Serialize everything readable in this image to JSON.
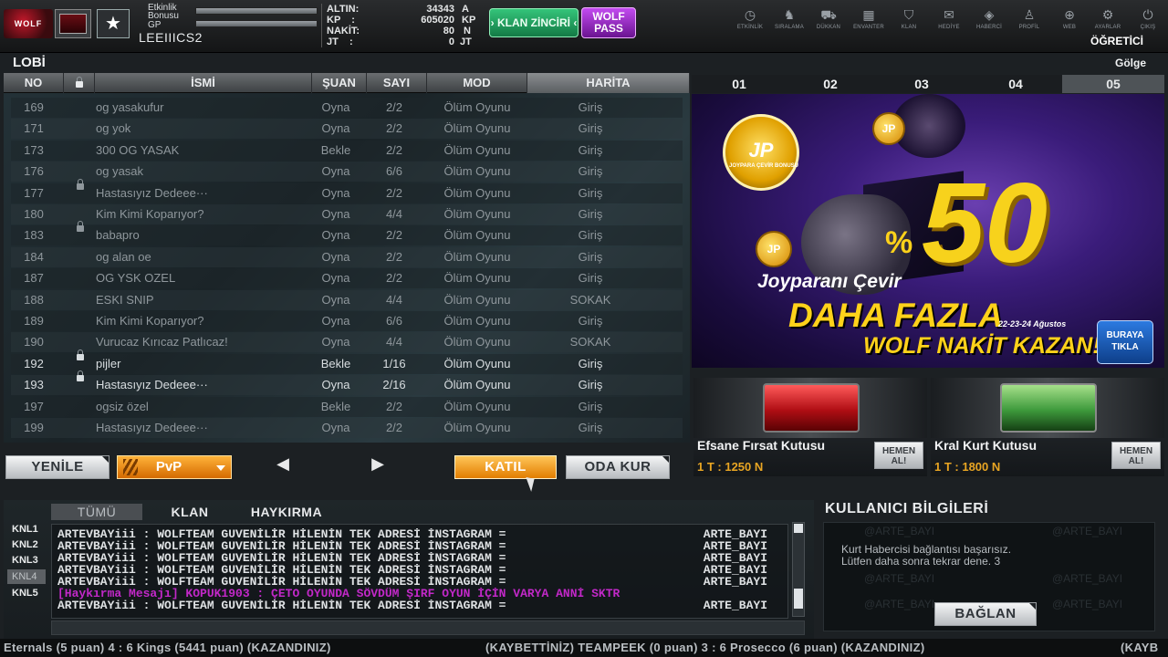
{
  "header": {
    "logo_text": "WOLF",
    "event_bonus_label": "Etkinlik\nBonusu",
    "gp_label": "GP",
    "nickname": "LEEIIICS2",
    "currencies": [
      {
        "label": "ALTIN:",
        "value": "34343",
        "unit": "A"
      },
      {
        "label": "KP    :",
        "value": "605020",
        "unit": "KP"
      },
      {
        "label": "NAKİT:",
        "value": "80",
        "unit": "N"
      },
      {
        "label": "JT    :",
        "value": "0",
        "unit": "JT"
      }
    ],
    "klan_chain_label": "› KLAN ZİNCİRİ ‹",
    "wolf_pass_label": "WOLF PASS",
    "tutor_label": "ÖĞRETİCİ"
  },
  "nav": [
    {
      "label": "ETKİNLİK",
      "icon": "clock-icon",
      "glyph": "◷"
    },
    {
      "label": "SIRALAMA",
      "icon": "ranking-icon",
      "glyph": "♞"
    },
    {
      "label": "DÜKKAN",
      "icon": "cart-icon",
      "glyph": "⛟"
    },
    {
      "label": "ENVANTER",
      "icon": "inventory-icon",
      "glyph": "▦"
    },
    {
      "label": "KLAN",
      "icon": "shield-icon",
      "glyph": "⛉"
    },
    {
      "label": "HEDİYE",
      "icon": "gift-icon",
      "glyph": "✉"
    },
    {
      "label": "HABERCİ",
      "icon": "megaphone-icon",
      "glyph": "◈"
    },
    {
      "label": "PROFİL",
      "icon": "profile-icon",
      "glyph": "♙"
    },
    {
      "label": "WEB",
      "icon": "globe-icon",
      "glyph": "⊕"
    },
    {
      "label": "AYARLAR",
      "icon": "gear-icon",
      "glyph": "⚙"
    },
    {
      "label": "ÇIKIŞ",
      "icon": "power-icon",
      "glyph": "⏻"
    }
  ],
  "lobby": {
    "title": "LOBİ",
    "shadow_label": "Gölge",
    "columns": [
      "NO",
      "İSMİ",
      "ŞUAN",
      "SAYI",
      "MOD",
      "HARİTA"
    ],
    "rooms": [
      {
        "no": "169",
        "locked": false,
        "name": "og yasakufur",
        "status": "Oyna",
        "count": "2/2",
        "mode": "Ölüm Oyunu",
        "map": "Giriş",
        "active": false
      },
      {
        "no": "171",
        "locked": false,
        "name": "og yok",
        "status": "Oyna",
        "count": "2/2",
        "mode": "Ölüm Oyunu",
        "map": "Giriş",
        "active": false
      },
      {
        "no": "173",
        "locked": false,
        "name": "300 OG YASAK",
        "status": "Bekle",
        "count": "2/2",
        "mode": "Ölüm Oyunu",
        "map": "Giriş",
        "active": false
      },
      {
        "no": "176",
        "locked": false,
        "name": "og yasak",
        "status": "Oyna",
        "count": "6/6",
        "mode": "Ölüm Oyunu",
        "map": "Giriş",
        "active": false
      },
      {
        "no": "177",
        "locked": true,
        "name": "Hastasıyız Dedeee···",
        "status": "Oyna",
        "count": "2/2",
        "mode": "Ölüm Oyunu",
        "map": "Giriş",
        "active": false
      },
      {
        "no": "180",
        "locked": false,
        "name": "Kim Kimi Koparıyor?",
        "status": "Oyna",
        "count": "4/4",
        "mode": "Ölüm Oyunu",
        "map": "Giriş",
        "active": false
      },
      {
        "no": "183",
        "locked": true,
        "name": "babapro",
        "status": "Oyna",
        "count": "2/2",
        "mode": "Ölüm Oyunu",
        "map": "Giriş",
        "active": false
      },
      {
        "no": "184",
        "locked": false,
        "name": "og alan oe",
        "status": "Oyna",
        "count": "2/2",
        "mode": "Ölüm Oyunu",
        "map": "Giriş",
        "active": false
      },
      {
        "no": "187",
        "locked": false,
        "name": "OG YSK OZEL",
        "status": "Oyna",
        "count": "2/2",
        "mode": "Ölüm Oyunu",
        "map": "Giriş",
        "active": false
      },
      {
        "no": "188",
        "locked": false,
        "name": "ESKI SNIP",
        "status": "Oyna",
        "count": "4/4",
        "mode": "Ölüm Oyunu",
        "map": "SOKAK",
        "active": false
      },
      {
        "no": "189",
        "locked": false,
        "name": "Kim Kimi Koparıyor?",
        "status": "Oyna",
        "count": "6/6",
        "mode": "Ölüm Oyunu",
        "map": "Giriş",
        "active": false
      },
      {
        "no": "190",
        "locked": false,
        "name": "Vurucaz Kırıcaz Patlıcaz!",
        "status": "Oyna",
        "count": "4/4",
        "mode": "Ölüm Oyunu",
        "map": "SOKAK",
        "active": false
      },
      {
        "no": "192",
        "locked": true,
        "name": "pijler",
        "status": "Bekle",
        "count": "1/16",
        "mode": "Ölüm Oyunu",
        "map": "Giriş",
        "active": true
      },
      {
        "no": "193",
        "locked": true,
        "name": "Hastasıyız Dedeee···",
        "status": "Oyna",
        "count": "2/16",
        "mode": "Ölüm Oyunu",
        "map": "Giriş",
        "active": true
      },
      {
        "no": "197",
        "locked": false,
        "name": "ogsiz özel",
        "status": "Bekle",
        "count": "2/2",
        "mode": "Ölüm Oyunu",
        "map": "Giriş",
        "active": false
      },
      {
        "no": "199",
        "locked": false,
        "name": "Hastasıyız Dedeee···",
        "status": "Oyna",
        "count": "2/2",
        "mode": "Ölüm Oyunu",
        "map": "Giriş",
        "active": false
      }
    ],
    "buttons": {
      "refresh": "YENİLE",
      "mode_select": "PvP",
      "prev": "◀",
      "next": "▶",
      "join": "KATIL",
      "create_room": "ODA KUR"
    }
  },
  "promo": {
    "tabs": [
      "01",
      "02",
      "03",
      "04",
      "05"
    ],
    "banner": {
      "badge": "JP",
      "badge_caption": "JOYPARA ÇEVİR BONUSU",
      "percent_sign": "%",
      "percent_value": "50",
      "line1": "Joyparanı Çevir",
      "line2": "DAHA FAZLA",
      "line3": "WOLF NAKİT KAZAN!",
      "dates": "22-23-24 Ağustos",
      "cta": "BURAYA TIKLA"
    },
    "shop": [
      {
        "name": "Efsane Fırsat Kutusu",
        "price": "1 T : 1250 N",
        "buy": "HEMEN AL!"
      },
      {
        "name": "Kral Kurt Kutusu",
        "price": "1 T : 1800 N",
        "buy": "HEMEN AL!"
      }
    ]
  },
  "chat": {
    "tabs": [
      "TÜMÜ",
      "KLAN",
      "HAYKIRMA"
    ],
    "channels": [
      "KNL1",
      "KNL2",
      "KNL3",
      "KNL4",
      "KNL5"
    ],
    "selected_channel": "KNL4",
    "lines": [
      {
        "text": "ARTEVBAYiii : WOLFTEAM GUVENİLİR HİLENİN TEK ADRESİ İNSTAGRAM =",
        "tail": "ARTE_BAYI",
        "shout": false
      },
      {
        "text": "ARTEVBAYiii : WOLFTEAM GUVENİLİR HİLENİN TEK ADRESİ İNSTAGRAM =",
        "tail": "ARTE_BAYI",
        "shout": false
      },
      {
        "text": "ARTEVBAYiii : WOLFTEAM GUVENİLİR HİLENİN TEK ADRESİ İNSTAGRAM =",
        "tail": "ARTE_BAYI",
        "shout": false
      },
      {
        "text": "ARTEVBAYiii : WOLFTEAM GUVENİLİR HİLENİN TEK ADRESİ İNSTAGRAM =",
        "tail": "ARTE_BAYI",
        "shout": false
      },
      {
        "text": "ARTEVBAYiii : WOLFTEAM GUVENİLİR HİLENİN TEK ADRESİ İNSTAGRAM =",
        "tail": "ARTE_BAYI",
        "shout": false
      },
      {
        "text": "[Haykırma Mesajı] KOPUK1903 : ÇETO OYUNDA SÖVDÜM ŞIRF OYUN İÇİN VARYA ANNİ SKTR",
        "tail": "",
        "shout": true
      },
      {
        "text": "ARTEVBAYiii : WOLFTEAM GUVENİLİR HİLENİN TEK ADRESİ İNSTAGRAM =",
        "tail": "ARTE_BAYI",
        "shout": false
      }
    ]
  },
  "user_info": {
    "title": "KULLANICI BİLGİLERİ",
    "message_line1": "Kurt Habercisi bağlantısı başarısız.",
    "message_line2": "Lütfen daha sonra tekrar dene. 3",
    "watermark": "@ARTE_BAYI",
    "connect_button": "BAĞLAN"
  },
  "ticker": {
    "left": "Eternals (5 puan) 4 : 6 Kings (5441 puan) (KAZANDINIZ)",
    "right": "(KAYBETTİNİZ) TEAMPEEK (0 puan) 3 : 6 Prosecco (6 puan) (KAZANDINIZ)",
    "edge": "(KAYB"
  }
}
